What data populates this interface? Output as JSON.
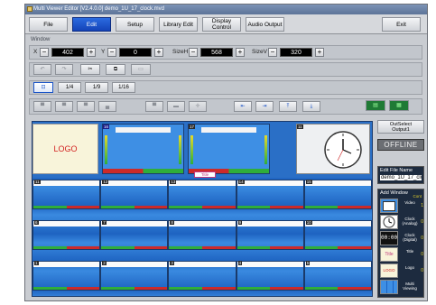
{
  "window": {
    "title": "Multi Viewer Editor [V2.4.0.0] demo_1U_17_clock.mvd"
  },
  "menu": [
    {
      "label": "File"
    },
    {
      "label": "Edit"
    },
    {
      "label": "Setup"
    },
    {
      "label": "Library Edit"
    },
    {
      "label": "Display Control"
    },
    {
      "label": "Audio Output"
    },
    {
      "label": "Exit"
    }
  ],
  "section_label": "Window",
  "position": {
    "x_label": "X",
    "x_value": "402",
    "y_label": "Y",
    "y_value": "0",
    "sizeh_label": "SizeH",
    "sizeh_value": "568",
    "sizev_label": "SizeV",
    "sizev_value": "320"
  },
  "zoom_buttons": [
    "1/4",
    "1/9",
    "1/16"
  ],
  "canvas": {
    "logo_text": "LOGO",
    "title_chip": "Title",
    "top_badges": [
      "16",
      "17",
      "11"
    ],
    "row_numbers": [
      [
        "11",
        "12",
        "13",
        "14",
        "15"
      ],
      [
        "6",
        "7",
        "8",
        "9",
        "10"
      ],
      [
        "1",
        "2",
        "3",
        "4",
        "5"
      ]
    ]
  },
  "right_panel": {
    "out_select_label": "OutSelect",
    "out_select_value": "Output1",
    "status": "OFFLINE",
    "edit_file_name_label": "Edit File Name",
    "edit_file_name_value": "demo_1U_17_clock",
    "add_window_label": "Add Window",
    "count_label": "Cont",
    "items": [
      {
        "name": "Video",
        "count": "1"
      },
      {
        "name": "Clock (Analog)",
        "count": "0"
      },
      {
        "name": "Clock (Digital)",
        "count": "0"
      },
      {
        "name": "Title",
        "count": "0"
      },
      {
        "name": "Logo",
        "count": "0"
      },
      {
        "name": "Multi Viewing",
        "count": ""
      }
    ],
    "digital_clock_text": "00:00",
    "title_thumb_text": "Title",
    "logo_thumb_text": "LOGO"
  }
}
